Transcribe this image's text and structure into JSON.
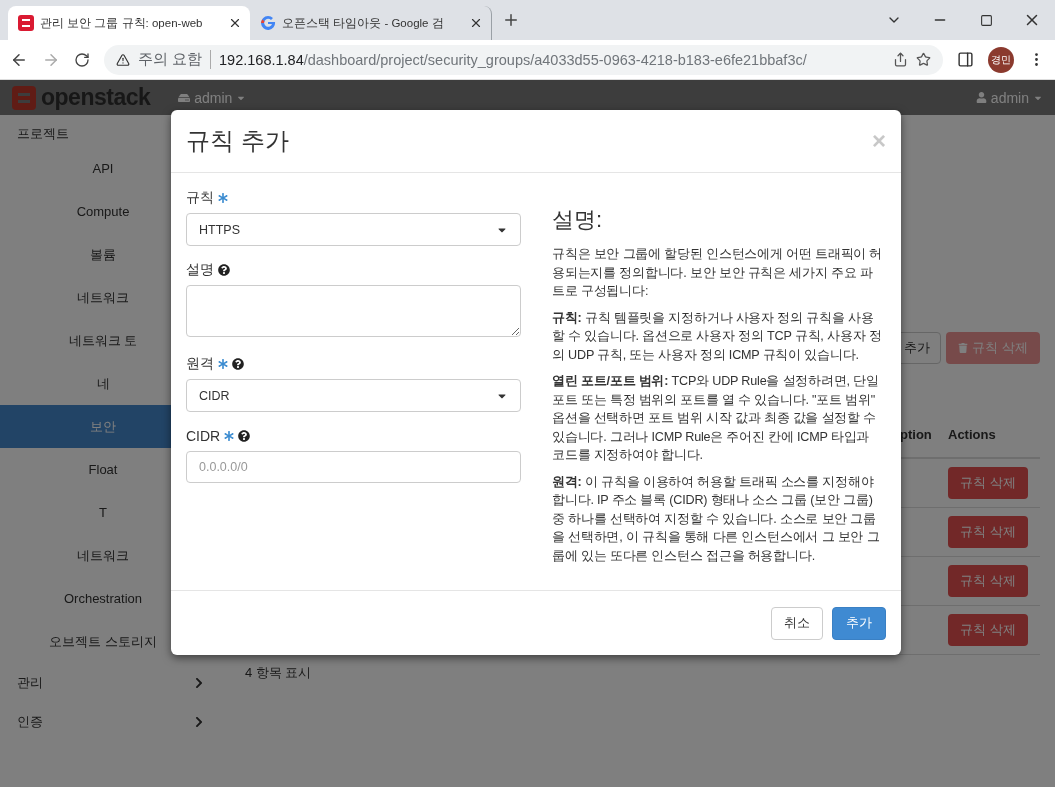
{
  "browser": {
    "tabs": [
      {
        "title": "관리 보안 그룹 규칙: open-web",
        "selected": true
      },
      {
        "title": "오픈스택 타임아웃 - Google 검",
        "selected": false
      }
    ],
    "address": {
      "security_label": "주의 요함",
      "host": "192.168.1.84",
      "path": "/dashboard/project/security_groups/a4033d55-0963-4218-b183-e6fe21bbaf3c/"
    },
    "profile": "경민"
  },
  "header": {
    "brand": "openstack",
    "project": "admin",
    "user": "admin"
  },
  "sidebar": {
    "section": "프로젝트",
    "items": [
      {
        "label": "API",
        "selected": false
      },
      {
        "label": "Compute",
        "selected": false
      },
      {
        "label": "볼륨",
        "selected": false
      },
      {
        "label": "네트워크",
        "selected": false
      },
      {
        "label": "네트워크 토",
        "selected": false
      },
      {
        "label": "네",
        "selected": false
      },
      {
        "label": "보안",
        "selected": true
      },
      {
        "label": "Float",
        "selected": false
      },
      {
        "label": "T",
        "selected": false
      },
      {
        "label": "네트워크",
        "selected": false
      },
      {
        "label": "Orchestration",
        "selected": false
      },
      {
        "label": "오브젝트 스토리지",
        "selected": false
      }
    ],
    "groups": [
      {
        "label": "관리"
      },
      {
        "label": "인증"
      }
    ]
  },
  "content": {
    "buttons": [
      {
        "label": "추가",
        "disabled": false
      },
      {
        "label": "규칙 삭제",
        "disabled": true
      }
    ],
    "table": {
      "columns": [
        "ption",
        "Actions"
      ],
      "rows": [
        {
          "action": "규칙 삭제"
        },
        {
          "action": "규칙 삭제"
        },
        {
          "action": "규칙 삭제"
        },
        {
          "action": "규칙 삭제"
        }
      ]
    },
    "footer": "4 항목 표시"
  },
  "modal": {
    "title": "규칙 추가",
    "close": "×",
    "fields": [
      {
        "kind": "select",
        "label": "규칙",
        "required": true,
        "help": false,
        "value": "HTTPS"
      },
      {
        "kind": "textarea",
        "label": "설명",
        "required": false,
        "help": true
      },
      {
        "kind": "select",
        "label": "원격",
        "required": true,
        "help": true,
        "value": "CIDR"
      },
      {
        "kind": "text",
        "label": "CIDR",
        "required": true,
        "help": true,
        "placeholder": "0.0.0.0/0"
      }
    ],
    "description_title": "설명:",
    "description": [
      "규칙은 보안 그룹에 할당된 인스턴스에게 어떤 트래픽이 허용되는지를 정의합니다. 보안 보안 규칙은 세가지 주요 파트로 구성됩니다:",
      "**규칙:** 규칙 템플릿을 지정하거나 사용자 정의 규칙을 사용할 수 있습니다. 옵션으로 사용자 정의 TCP 규칙, 사용자 정의 UDP 규칙, 또는 사용자 정의 ICMP 규칙이 있습니다.",
      "**열린 포트/포트 범위:** TCP와 UDP Rule을 설정하려면, 단일 포트 또는 특정 범위의 포트를 열 수 있습니다. \"포트 범위\" 옵션을 선택하면 포트 범위 시작 값과 최종 값을 설정할 수 있습니다. 그러나 ICMP Rule은 주어진 칸에 ICMP 타입과 코드를 지정하여야 합니다.",
      "**원격:** 이 규칙을 이용하여 허용할 트래픽 소스를 지정해야 합니다. IP 주소 블록 (CIDR) 형태나 소스 그룹 (보안 그룹) 중 하나를 선택하여 지정할 수 있습니다. 소스로 보안 그룹을 선택하면, 이 규칙을 통해 다른 인스턴스에서 그 보안 그룹에 있는 또다른 인스턴스 접근을 허용합니다."
    ],
    "cancel": "취소",
    "submit": "추가"
  }
}
